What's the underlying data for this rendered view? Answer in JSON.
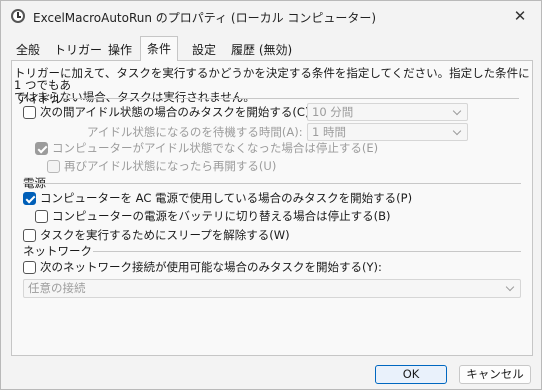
{
  "window": {
    "title": "ExcelMacroAutoRun のプロパティ (ローカル コンピューター)",
    "close_glyph": "✕"
  },
  "tabs": [
    {
      "label": "全般",
      "active": false
    },
    {
      "label": "トリガー",
      "active": false
    },
    {
      "label": "操作",
      "active": false
    },
    {
      "label": "条件",
      "active": true
    },
    {
      "label": "設定",
      "active": false
    },
    {
      "label": "履歴 (無効)",
      "active": false
    }
  ],
  "description_line1": "トリガーに加えて、タスクを実行するかどうかを決定する条件を指定してください。指定した条件に 1 つでもあ",
  "description_line2": "てはまらない場合、タスクは実行されません。",
  "idle": {
    "heading": "アイドル",
    "start_only_idle": {
      "label": "次の間アイドル状態の場合のみタスクを開始する(C):",
      "checked": false
    },
    "idle_duration": {
      "value": "10 分間"
    },
    "wait_label": "アイドル状態になるのを待機する時間(A):",
    "wait_duration": {
      "value": "1 時間"
    },
    "stop_if_not_idle": {
      "label": "コンピューターがアイドル状態でなくなった場合は停止する(E)",
      "checked": true,
      "disabled": true
    },
    "restart_if_idle": {
      "label": "再びアイドル状態になったら再開する(U)",
      "checked": false,
      "disabled": true
    }
  },
  "power": {
    "heading": "電源",
    "ac_only": {
      "label": "コンピューターを AC 電源で使用している場合のみタスクを開始する(P)",
      "checked": true
    },
    "stop_on_battery": {
      "label": "コンピューターの電源をバッテリに切り替える場合は停止する(B)",
      "checked": false
    },
    "wake_to_run": {
      "label": "タスクを実行するためにスリープを解除する(W)",
      "checked": false
    }
  },
  "network": {
    "heading": "ネットワーク",
    "start_if_network": {
      "label": "次のネットワーク接続が使用可能な場合のみタスクを開始する(Y):",
      "checked": false
    },
    "connection": {
      "value": "任意の接続"
    }
  },
  "buttons": {
    "ok_label": "OK",
    "cancel_label": "キャンセル"
  }
}
